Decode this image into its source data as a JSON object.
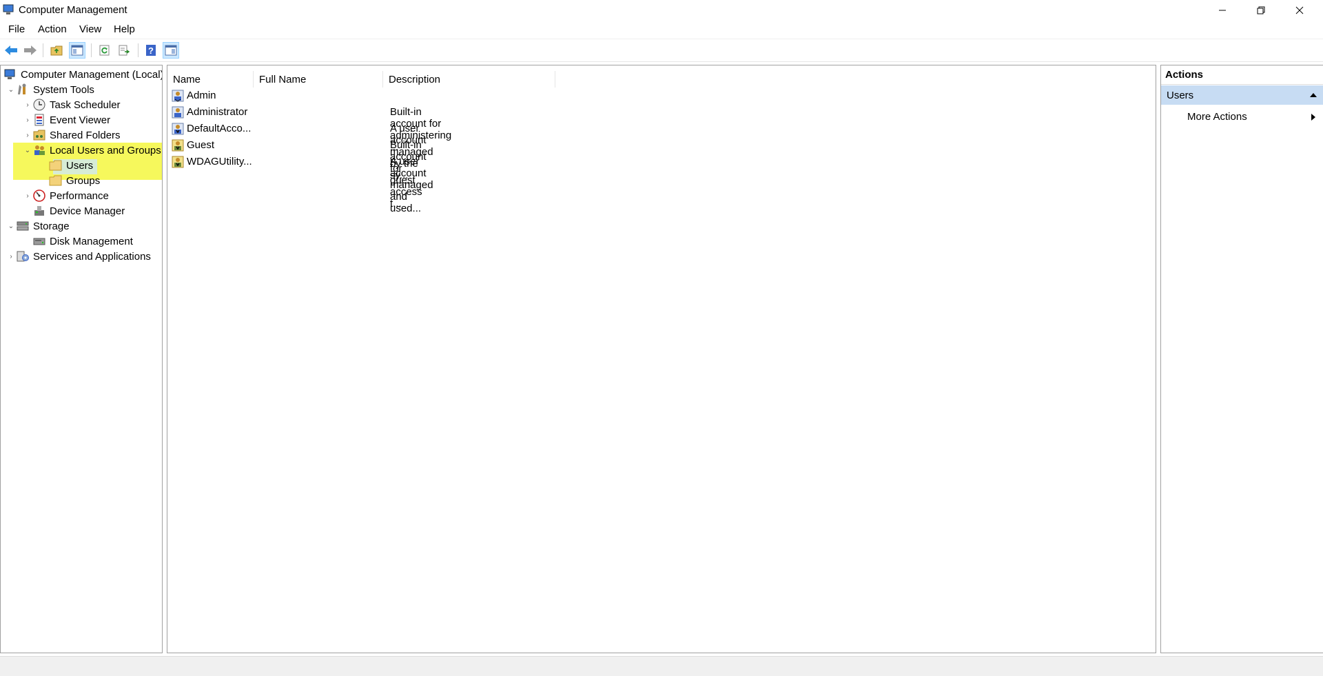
{
  "window": {
    "title": "Computer Management"
  },
  "menu": [
    "File",
    "Action",
    "View",
    "Help"
  ],
  "tree": {
    "root": "Computer Management (Local)",
    "system_tools": "System Tools",
    "task_scheduler": "Task Scheduler",
    "event_viewer": "Event Viewer",
    "shared_folders": "Shared Folders",
    "local_users_groups": "Local Users and Groups",
    "users": "Users",
    "groups": "Groups",
    "performance": "Performance",
    "device_manager": "Device Manager",
    "storage": "Storage",
    "disk_management": "Disk Management",
    "services_apps": "Services and Applications"
  },
  "list": {
    "columns": [
      "Name",
      "Full Name",
      "Description"
    ],
    "rows": [
      {
        "name": "Admin",
        "full_name": "",
        "description": ""
      },
      {
        "name": "Administrator",
        "full_name": "",
        "description": "Built-in account for administering ..."
      },
      {
        "name": "DefaultAcco...",
        "full_name": "",
        "description": "A user account managed by the sy..."
      },
      {
        "name": "Guest",
        "full_name": "",
        "description": "Built-in account for guest access t..."
      },
      {
        "name": "WDAGUtility...",
        "full_name": "",
        "description": "A user account managed and used..."
      }
    ]
  },
  "actions": {
    "title": "Actions",
    "section": "Users",
    "more_actions": "More Actions"
  },
  "colors": {
    "highlight": "#f4f740",
    "selection": "#cce8ff",
    "section": "#c7dcf3"
  }
}
